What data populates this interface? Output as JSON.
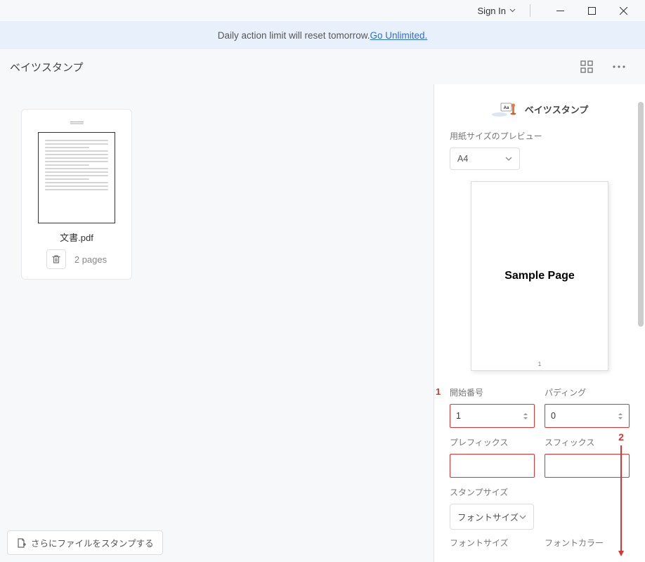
{
  "titlebar": {
    "signin": "Sign In"
  },
  "banner": {
    "text": "Daily action limit will reset tomorrow. ",
    "link": "Go Unlimited."
  },
  "header": {
    "title": "ベイツスタンプ"
  },
  "file": {
    "name": "文書.pdf",
    "pages": "2 pages"
  },
  "addmore": {
    "label": "さらにファイルをスタンプする"
  },
  "panel": {
    "title": "ベイツスタンプ",
    "paper_preview_label": "用紙サイズのプレビュー",
    "paper_size": "A4",
    "sample_page": "Sample Page",
    "sample_num": "1",
    "start_number_label": "開始番号",
    "start_number_value": "1",
    "padding_label": "パディング",
    "padding_value": "0",
    "prefix_label": "プレフィックス",
    "prefix_value": "",
    "suffix_label": "スフィックス",
    "suffix_value": "",
    "stamp_size_label": "スタンプサイズ",
    "font_size_label": "フォントサイズ",
    "font_size_bottom": "フォントサイズ",
    "font_color_bottom": "フォントカラー"
  },
  "annotations": {
    "marker1": "1",
    "marker2": "2"
  }
}
